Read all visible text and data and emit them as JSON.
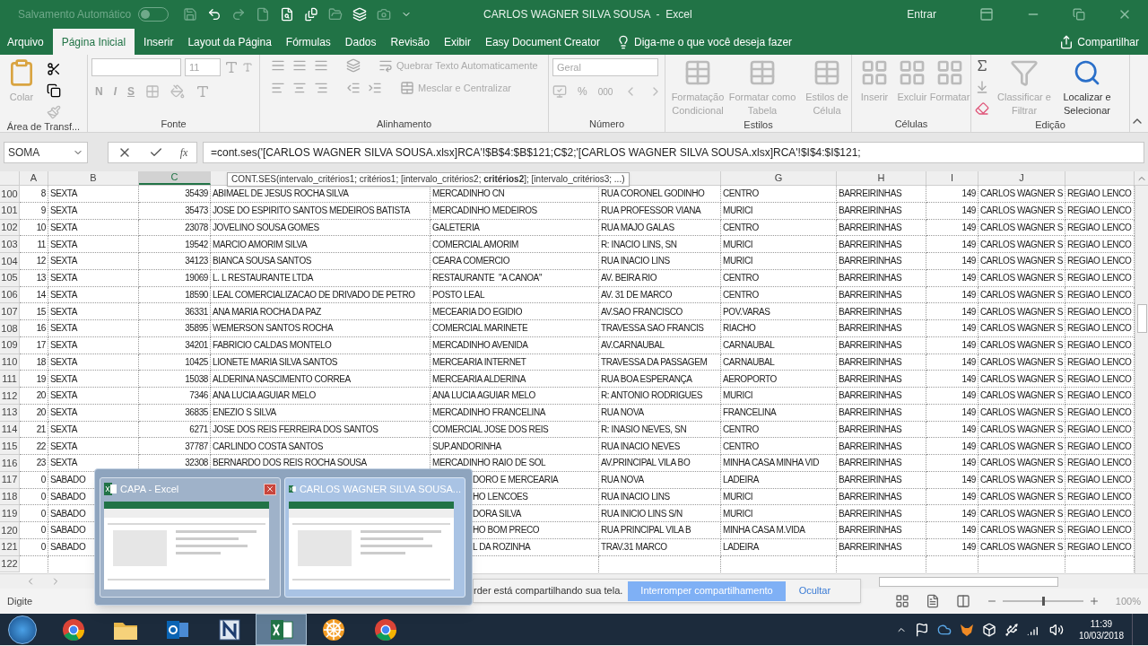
{
  "title_bar": {
    "autosave_label": "Salvamento Automático",
    "autosave_on": false,
    "title": "CARLOS WAGNER SILVA SOUSA  -  Excel",
    "sign_in": "Entrar"
  },
  "menu_tabs": [
    {
      "label": "Arquivo",
      "selected": false
    },
    {
      "label": "Página Inicial",
      "selected": true
    },
    {
      "label": "Inserir",
      "selected": false
    },
    {
      "label": "Layout da Página",
      "selected": false
    },
    {
      "label": "Fórmulas",
      "selected": false
    },
    {
      "label": "Dados",
      "selected": false
    },
    {
      "label": "Revisão",
      "selected": false
    },
    {
      "label": "Exibir",
      "selected": false
    },
    {
      "label": "Easy Document Creator",
      "selected": false
    }
  ],
  "tell_me": "Diga-me o que você deseja fazer",
  "share": "Compartilhar",
  "ribbon": {
    "paste": "Colar",
    "font_size": "11",
    "bold": "N",
    "italic": "I",
    "underline": "S",
    "wrap_text": "Quebrar Texto Automaticamente",
    "merge": "Mesclar e Centralizar",
    "number_format": "Geral",
    "percent": "%",
    "thousands": "000",
    "styles": [
      "Formatação Condicional",
      "Formatar como Tabela",
      "Estilos de Célula"
    ],
    "cells": [
      "Inserir",
      "Excluir",
      "Formatar"
    ],
    "sort": "Classificar e Filtrar",
    "find": "Localizar e Selecionar",
    "groups": [
      "Área de Transf...",
      "Fonte",
      "Alinhamento",
      "Número",
      "Estilos",
      "Células",
      "Edição"
    ]
  },
  "formula_bar": {
    "name_box": "SOMA",
    "fx": "fx",
    "formula": "=cont.ses('[CARLOS WAGNER SILVA SOUSA.xlsx]RCA'!$B$4:$B$121;C$2;'[CARLOS WAGNER SILVA SOUSA.xlsx]RCA'!$I$4:$I$121;",
    "tooltip": "CONT.SES(intervalo_critérios1; critérios1; [intervalo_critérios2; **critérios2**]; [intervalo_critérios3; ...)"
  },
  "column_headers": [
    {
      "label": "A",
      "selected": false
    },
    {
      "label": "B",
      "selected": false
    },
    {
      "label": "C",
      "selected": true
    },
    {
      "label": "G",
      "selected": false
    },
    {
      "label": "H",
      "selected": false
    },
    {
      "label": "I",
      "selected": false
    },
    {
      "label": "J",
      "selected": false
    }
  ],
  "rows": [
    {
      "number": "100",
      "covered": false,
      "cells": [
        "8",
        "SEXTA",
        "35439",
        "ABIMAEL DE JESUS ROCHA SILVA",
        "MERCADINHO CN",
        "RUA CORONEL GODINHO",
        "CENTRO",
        "BARREIRINHAS",
        "149",
        "CARLOS WAGNER S",
        "REGIAO LENCO"
      ]
    },
    {
      "number": "101",
      "covered": false,
      "cells": [
        "9",
        "SEXTA",
        "35473",
        "JOSE DO ESPIRITO SANTOS MEDEIROS BATISTA",
        "MERCADINHO MEDEIROS",
        "RUA PROFESSOR VIANA",
        "MURICI",
        "BARREIRINHAS",
        "149",
        "CARLOS WAGNER S",
        "REGIAO LENCO"
      ]
    },
    {
      "number": "102",
      "covered": false,
      "cells": [
        "10",
        "SEXTA",
        "23078",
        "JOVELINO SOUSA GOMES",
        "GALETERIA",
        "RUA MAJO GALAS",
        "CENTRO",
        "BARREIRINHAS",
        "149",
        "CARLOS WAGNER S",
        "REGIAO LENCO"
      ]
    },
    {
      "number": "103",
      "covered": false,
      "cells": [
        "11",
        "SEXTA",
        "19542",
        "MARCIO AMORIM SILVA",
        "COMERCIAL AMORIM",
        "R: INACIO LINS, SN",
        "MURICI",
        "BARREIRINHAS",
        "149",
        "CARLOS WAGNER S",
        "REGIAO LENCO"
      ]
    },
    {
      "number": "104",
      "covered": false,
      "cells": [
        "12",
        "SEXTA",
        "34123",
        "BIANCA SOUSA SANTOS",
        "CEARA COMERCIO",
        "RUA INACIO LINS",
        "MURICI",
        "BARREIRINHAS",
        "149",
        "CARLOS WAGNER S",
        "REGIAO LENCO"
      ]
    },
    {
      "number": "105",
      "covered": false,
      "cells": [
        "13",
        "SEXTA",
        "19069",
        "L. L RESTAURANTE LTDA",
        "RESTAURANTE  \"A CANOA\"",
        "AV. BEIRA RIO",
        "CENTRO",
        "BARREIRINHAS",
        "149",
        "CARLOS WAGNER S",
        "REGIAO LENCO"
      ]
    },
    {
      "number": "106",
      "covered": false,
      "cells": [
        "14",
        "SEXTA",
        "18590",
        "LEAL COMERCIALIZACAO DE DRIVADO DE PETRO",
        "POSTO LEAL",
        "AV. 31 DE MARCO",
        "CENTRO",
        "BARREIRINHAS",
        "149",
        "CARLOS WAGNER S",
        "REGIAO LENCO"
      ]
    },
    {
      "number": "107",
      "covered": false,
      "cells": [
        "15",
        "SEXTA",
        "36331",
        "ANA MARIA ROCHA DA PAZ",
        "MECEARIA DO EGIDIO",
        "AV.SAO FRANCISCO",
        "POV.VARAS",
        "BARREIRINHAS",
        "149",
        "CARLOS WAGNER S",
        "REGIAO LENCO"
      ]
    },
    {
      "number": "108",
      "covered": false,
      "cells": [
        "16",
        "SEXTA",
        "35895",
        "WEMERSON SANTOS ROCHA",
        "COMERCIAL MARINETE",
        "TRAVESSA SAO FRANCIS",
        "RIACHO",
        "BARREIRINHAS",
        "149",
        "CARLOS WAGNER S",
        "REGIAO LENCO"
      ]
    },
    {
      "number": "109",
      "covered": false,
      "cells": [
        "17",
        "SEXTA",
        "34201",
        "FABRICIO CALDAS MONTELO",
        "MERCADINHO AVENIDA",
        "AV.CARNAUBAL",
        "CARNAUBAL",
        "BARREIRINHAS",
        "149",
        "CARLOS WAGNER S",
        "REGIAO LENCO"
      ]
    },
    {
      "number": "110",
      "covered": false,
      "cells": [
        "18",
        "SEXTA",
        "10425",
        "LIONETE MARIA SILVA SANTOS",
        "MERCEARIA INTERNET",
        "TRAVESSA DA PASSAGEM",
        "CARNAUBAL",
        "BARREIRINHAS",
        "149",
        "CARLOS WAGNER S",
        "REGIAO LENCO"
      ]
    },
    {
      "number": "111",
      "covered": false,
      "cells": [
        "19",
        "SEXTA",
        "15038",
        "ALDERINA NASCIMENTO CORREA",
        "MERCEARIA ALDERINA",
        "RUA BOA ESPERANÇA",
        "AEROPORTO",
        "BARREIRINHAS",
        "149",
        "CARLOS WAGNER S",
        "REGIAO LENCO"
      ]
    },
    {
      "number": "112",
      "covered": false,
      "cells": [
        "20",
        "SEXTA",
        "7346",
        "ANA LUCIA AGUIAR MELO",
        "ANA LUCIA AGUIAR MELO",
        "R: ANTONIO RODRIGUES",
        "MURICI",
        "BARREIRINHAS",
        "149",
        "CARLOS WAGNER S",
        "REGIAO LENCO"
      ]
    },
    {
      "number": "113",
      "covered": false,
      "cells": [
        "20",
        "SEXTA",
        "36835",
        "ENEZIO S SILVA",
        "MERCADINHO FRANCELINA",
        "RUA NOVA",
        "FRANCELINA",
        "BARREIRINHAS",
        "149",
        "CARLOS WAGNER S",
        "REGIAO LENCO"
      ]
    },
    {
      "number": "114",
      "covered": false,
      "cells": [
        "21",
        "SEXTA",
        "6271",
        "JOSE DOS REIS FERREIRA DOS SANTOS",
        "COMERCIAL JOSE DOS REIS",
        "R: INASIO NEVES, SN",
        "CENTRO",
        "BARREIRINHAS",
        "149",
        "CARLOS WAGNER S",
        "REGIAO LENCO"
      ]
    },
    {
      "number": "115",
      "covered": false,
      "cells": [
        "22",
        "SEXTA",
        "37787",
        "CARLINDO COSTA SANTOS",
        "SUP.ANDORINHA",
        "RUA INACIO NEVES",
        "CENTRO",
        "BARREIRINHAS",
        "149",
        "CARLOS WAGNER S",
        "REGIAO LENCO"
      ]
    },
    {
      "number": "116",
      "covered": false,
      "cells": [
        "23",
        "SEXTA",
        "32308",
        "BERNARDO DOS REIS ROCHA SOUSA",
        "MERCADINHO RAIO DE SOL",
        "AV.PRINCIPAL VILA BO",
        "MINHA CASA MINHA VID",
        "BARREIRINHAS",
        "149",
        "CARLOS WAGNER S",
        "REGIAO LENCO"
      ]
    },
    {
      "number": "117",
      "covered": true,
      "cells": [
        "0",
        "SABADO",
        null,
        null,
        "DORO E MERCEARIA",
        "RUA NOVA",
        "LADEIRA",
        "BARREIRINHAS",
        "149",
        "CARLOS WAGNER S",
        "REGIAO LENCO"
      ]
    },
    {
      "number": "118",
      "covered": true,
      "cells": [
        "0",
        "SABADO",
        null,
        null,
        "HO LENCOES",
        "RUA INACIO LINS",
        "MURICI",
        "BARREIRINHAS",
        "149",
        "CARLOS WAGNER S",
        "REGIAO LENCO"
      ]
    },
    {
      "number": "119",
      "covered": true,
      "cells": [
        "0",
        "SABADO",
        null,
        null,
        "DORA SILVA",
        "RUA INICIO LINS S/N",
        "MURICI",
        "BARREIRINHAS",
        "149",
        "CARLOS WAGNER S",
        "REGIAO LENCO"
      ]
    },
    {
      "number": "120",
      "covered": true,
      "cells": [
        "0",
        "SABADO",
        null,
        null,
        "HO BOM PRECO",
        "RUA PRINCIPAL VILA B",
        "MINHA CASA M.VIDA",
        "BARREIRINHAS",
        "149",
        "CARLOS WAGNER S",
        "REGIAO LENCO"
      ]
    },
    {
      "number": "121",
      "covered": true,
      "cells": [
        "0",
        "SABADO",
        null,
        null,
        "L DA ROZINHA",
        "TRAV.31 MARCO",
        "LADEIRA",
        "BARREIRINHAS",
        "149",
        "CARLOS WAGNER S",
        "REGIAO LENCO"
      ]
    },
    {
      "number": "122"
    }
  ],
  "window_previews": [
    {
      "title": "CAPA - Excel",
      "selected": false,
      "hovered": true
    },
    {
      "title": "CARLOS WAGNER SILVA SOUSA...",
      "selected": true,
      "hovered": false
    }
  ],
  "share_notice": {
    "text": "rder está compartilhando sua tela.",
    "button": "Interromper compartilhamento",
    "link": "Ocultar"
  },
  "status_bar": {
    "mode": "Digite",
    "zoom": "100%"
  },
  "taskbar": {
    "apps": [
      {
        "kind": "chrome",
        "active": false
      },
      {
        "kind": "folder",
        "active": false
      },
      {
        "kind": "mail",
        "active": false
      },
      {
        "kind": "notes",
        "active": false
      },
      {
        "kind": "excel",
        "active": true
      },
      {
        "kind": "wheel",
        "active": false
      },
      {
        "kind": "chrome",
        "active": false
      }
    ],
    "time": "11:39",
    "date": "10/03/2018"
  }
}
